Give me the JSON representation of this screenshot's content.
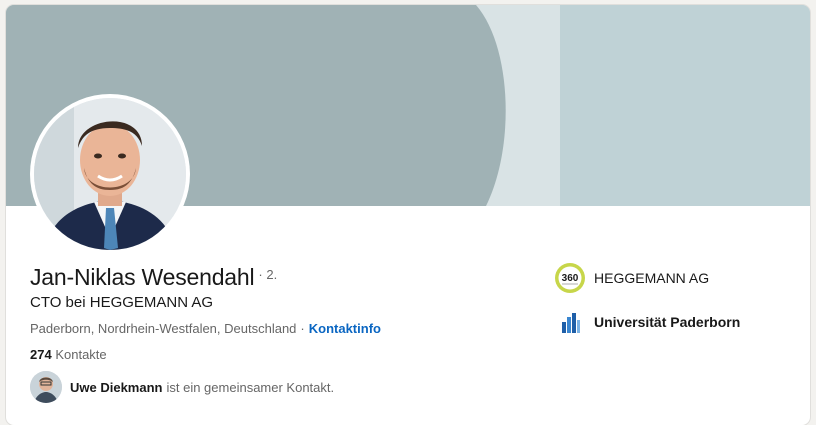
{
  "profile": {
    "name": "Jan-Niklas Wesendahl",
    "degree": "· 2.",
    "headline": "CTO bei HEGGEMANN AG",
    "location": "Paderborn, Nordrhein-Westfalen, Deutschland",
    "separator": "·",
    "contact_info_label": "Kontaktinfo",
    "connections_count": "274",
    "connections_label": "Kontakte",
    "mutual_name": "Uwe Diekmann",
    "mutual_text": "ist ein gemeinsamer Kontakt."
  },
  "affiliations": [
    {
      "name": "HEGGEMANN AG",
      "logo": "heggemann-360-logo"
    },
    {
      "name": "Universität Paderborn",
      "logo": "universitaet-paderborn-logo"
    }
  ],
  "colors": {
    "banner_left": "#a0b2b5",
    "banner_mid": "#d9e3e5",
    "banner_right": "#bfd2d6",
    "link": "#0a66c2"
  }
}
